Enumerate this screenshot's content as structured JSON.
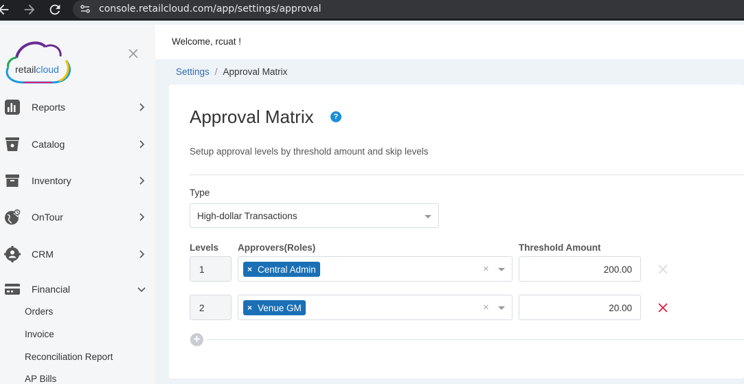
{
  "browser": {
    "url": "console.retailcloud.com/app/settings/approval"
  },
  "sidebar": {
    "logo_text_main": "retail",
    "logo_text_accent": "cloud",
    "items": [
      {
        "label": "Reports",
        "icon": "bar-chart-icon"
      },
      {
        "label": "Catalog",
        "icon": "shopping-bag-icon"
      },
      {
        "label": "Inventory",
        "icon": "archive-box-icon"
      },
      {
        "label": "OnTour",
        "icon": "globe-tour-icon"
      },
      {
        "label": "CRM",
        "icon": "crm-gear-icon"
      },
      {
        "label": "Financial",
        "icon": "credit-card-icon"
      }
    ],
    "financial_sub": [
      "Orders",
      "Invoice",
      "Reconciliation Report",
      "AP Bills"
    ]
  },
  "header": {
    "welcome": "Welcome, rcuat !"
  },
  "breadcrumb": {
    "parent": "Settings",
    "separator": "/",
    "current": "Approval Matrix"
  },
  "page": {
    "title": "Approval Matrix",
    "help": "?",
    "subtitle": "Setup approval levels by threshold amount and skip levels",
    "type_label": "Type",
    "type_value": "High-dollar Transactions",
    "columns": {
      "levels": "Levels",
      "approvers": "Approvers(Roles)",
      "threshold": "Threshold Amount"
    },
    "rows": [
      {
        "level": "1",
        "approver": "Central Admin",
        "threshold": "200.00",
        "delete_enabled": false
      },
      {
        "level": "2",
        "approver": "Venue GM",
        "threshold": "20.00",
        "delete_enabled": true
      }
    ],
    "chip_remove": "×",
    "clear": "×",
    "add": "+"
  },
  "colors": {
    "chip": "#1a6fb5",
    "delete_active": "#e0193f",
    "delete_disabled": "#dddddd",
    "link": "#2b6cb0"
  }
}
